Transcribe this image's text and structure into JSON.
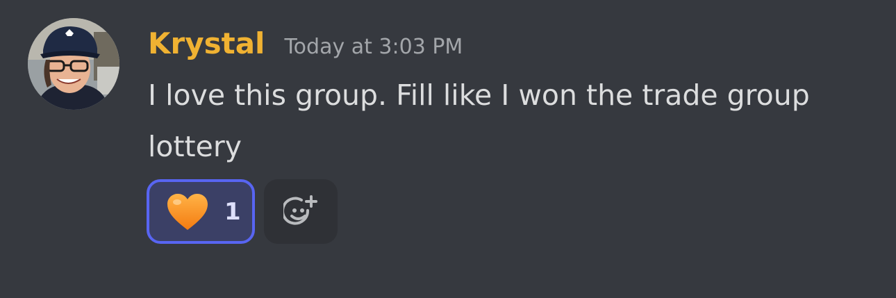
{
  "message": {
    "author": "Krystal",
    "timestamp": "Today at 3:03 PM",
    "text": "I love this group. Fill like I won the trade group lottery",
    "author_color": "#f0b232"
  },
  "reactions": [
    {
      "emoji": "orange-heart",
      "count": "1",
      "selected": true
    }
  ],
  "add_reaction": {
    "icon": "add-reaction-smiley-icon"
  }
}
